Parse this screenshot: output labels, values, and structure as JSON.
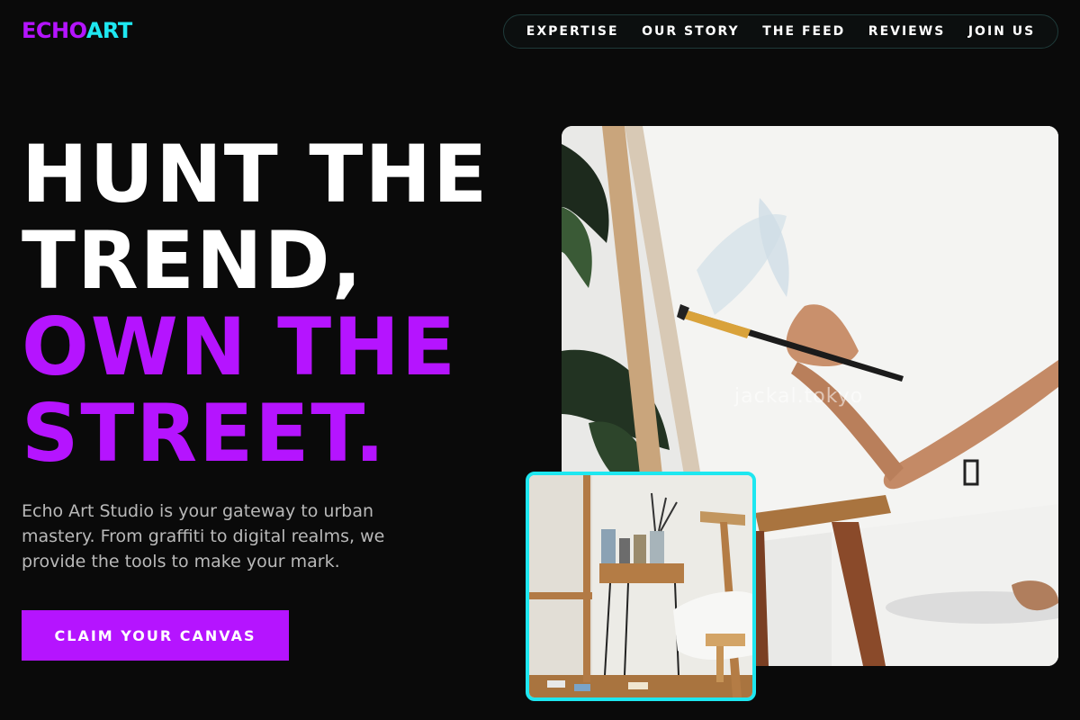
{
  "brand": {
    "logo_part1": "ECHO",
    "logo_part2": "ART",
    "accent": "#b514ff",
    "secondary": "#1ee7f0"
  },
  "nav": {
    "items": [
      "EXPERTISE",
      "OUR STORY",
      "THE FEED",
      "REVIEWS",
      "JOIN US"
    ]
  },
  "hero": {
    "line1": "HUNT THE",
    "line2": "TREND,",
    "line3": "OWN THE",
    "line4": "STREET.",
    "description": "Echo Art Studio is your gateway to urban mastery. From graffiti to digital realms, we provide the tools to make your mark.",
    "cta_label": "CLAIM YOUR CANVAS",
    "image_watermark": "jackal.tokyo"
  }
}
